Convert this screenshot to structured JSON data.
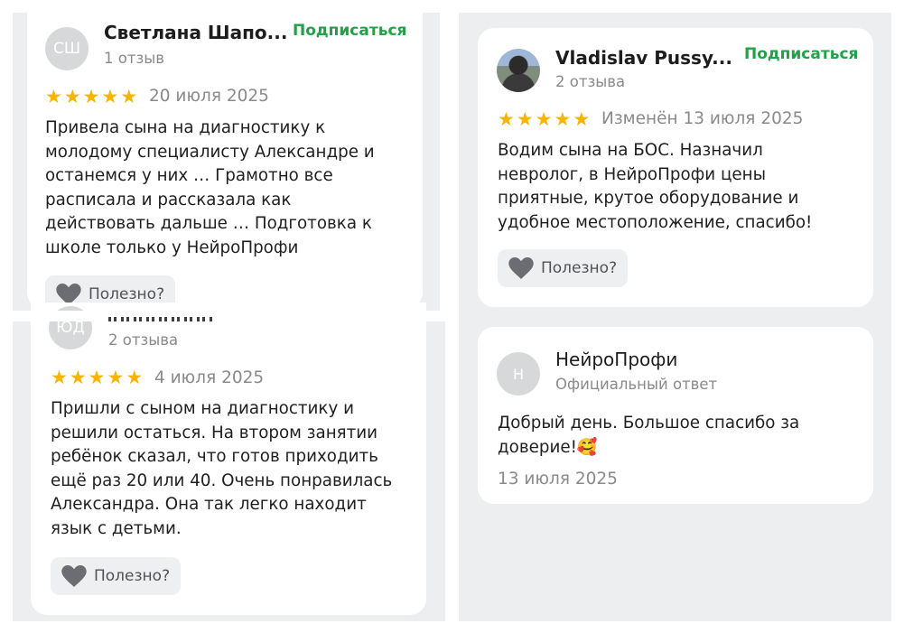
{
  "colors": {
    "panel_bg": "#eceef0",
    "card_bg": "#ffffff",
    "star": "#f7b500",
    "subscribe": "#24a148",
    "muted": "#8a8a8e"
  },
  "reviews": [
    {
      "avatar_initials": "СШ",
      "name": "Светлана Шапо...",
      "reviews_count": "1 отзыв",
      "subscribe_label": "Подписаться",
      "rating": 5,
      "date": "20 июля 2025",
      "text": "Привела сына на диагностику к\nмолодому специалисту Александре и\nостанемся у них … Грамотно все\nрасписала и рассказала как\nдействовать дальше … Подготовка к\nшколе только у НейроПрофи",
      "useful_label": "Полезно?"
    },
    {
      "avatar_initials": "ЮД",
      "name": "",
      "reviews_count": "2 отзыва",
      "rating": 5,
      "date": "4 июля 2025",
      "text": "Пришли с сыном на диагностику и\nрешили остаться. На втором занятии\nребёнок сказал, что готов приходить\nещё раз 20 или 40. Очень понравилась\nАлександра. Она так легко находит\nязык с детьми.",
      "useful_label": "Полезно?"
    },
    {
      "avatar_icon": "user-photo-avatar",
      "name": "Vladislav Pussy...",
      "reviews_count": "2 отзыва",
      "subscribe_label": "Подписаться",
      "rating": 5,
      "date": "Изменён 13 июля 2025",
      "text": "Водим сына на БОС. Назначил\nневролог, в НейроПрофи цены\nприятные, крутое оборудование и\nудобное местоположение, спасибо!",
      "useful_label": "Полезно?"
    }
  ],
  "reply": {
    "avatar_initials": "Н",
    "name": "НейроПрофи",
    "subtitle": "Официальный ответ",
    "text": "Добрый день. Большое спасибо за\nдоверие!🥰",
    "date": "13 июля 2025"
  },
  "icons": {
    "star": "star-icon",
    "heart": "heart-icon"
  }
}
